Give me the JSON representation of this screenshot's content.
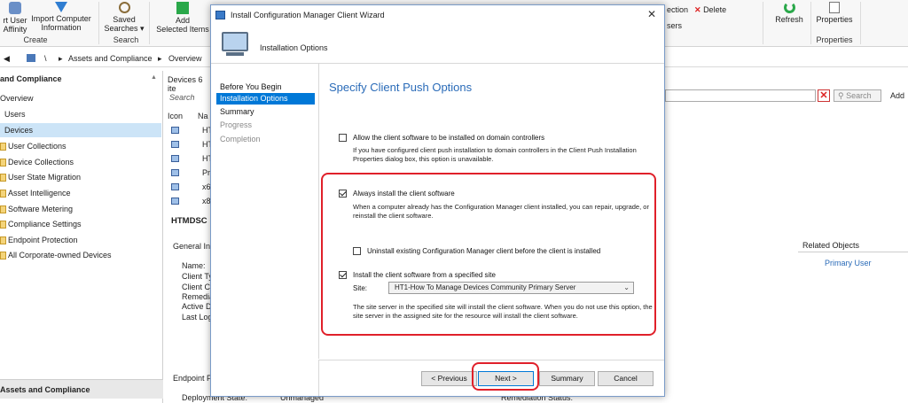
{
  "ribbon": {
    "user_affinity": [
      "rt User",
      "Affinity"
    ],
    "import_computer": [
      "Import Computer",
      "Information"
    ],
    "saved_searches": [
      "Saved",
      "Searches ▾"
    ],
    "add_selected": [
      "Add",
      "Selected Items"
    ],
    "collection_frag": "ection",
    "delete": "Delete",
    "users_frag": "sers",
    "refresh": "Refresh",
    "properties": "Properties",
    "group_create": "Create",
    "group_search": "Search",
    "group_properties": "Properties"
  },
  "address": {
    "root": "\\",
    "crumb1": "Assets and Compliance",
    "crumb2": "Overview",
    "sep": "▸"
  },
  "nav": {
    "header": "and Compliance",
    "items": [
      "Overview",
      "Users",
      "Devices",
      "User Collections",
      "Device Collections",
      "User State Migration",
      "Asset Intelligence",
      "Software Metering",
      "Compliance Settings",
      "Endpoint Protection",
      "All Corporate-owned Devices"
    ],
    "footer": "Assets and Compliance"
  },
  "devices": {
    "header": "Devices 6 ite",
    "search_placeholder": "Search",
    "col_icon": "Icon",
    "col_name": "Na",
    "rows": [
      "HT",
      "HT",
      "HT",
      "Pr",
      "x6",
      "x8"
    ]
  },
  "detail": {
    "name": "HTMDSC",
    "general": "General In",
    "fields": [
      "Name:",
      "Client Ty",
      "Client Ch",
      "Remedia",
      "Active D",
      "Last Log"
    ],
    "endpoint": "Endpoint P",
    "deployment_state_label": "Deployment State:",
    "deployment_state_value": "Unmanaged",
    "remediation_status": "Remediation Status:",
    "related_objects": "Related Objects",
    "primary_user": "Primary User"
  },
  "right_toolbar": {
    "search_button": "Search",
    "add": "Add"
  },
  "dialog": {
    "title": "Install Configuration Manager Client Wizard",
    "header": "Installation Options",
    "steps": [
      {
        "label": "Before You Begin",
        "state": "done"
      },
      {
        "label": "Installation Options",
        "state": "active"
      },
      {
        "label": "Summary",
        "state": "done"
      },
      {
        "label": "Progress",
        "state": "dim"
      },
      {
        "label": "Completion",
        "state": "dim"
      }
    ],
    "page_title": "Specify Client Push Options",
    "opt_domain_controllers": {
      "label": "Allow the client software to be installed on domain controllers",
      "checked": false,
      "note": "If you have configured client push installation to domain controllers in the Client Push Installation Properties dialog box, this option is unavailable."
    },
    "opt_always_install": {
      "label": "Always install the client software",
      "checked": true,
      "note": "When a computer already has the Configuration Manager client installed, you can repair, upgrade, or reinstall the client software."
    },
    "opt_uninstall": {
      "label": "Uninstall existing Configuration Manager client before the client is installed",
      "checked": false
    },
    "opt_specified_site": {
      "label": "Install the client software from a specified site",
      "checked": true
    },
    "site_label": "Site:",
    "site_value": "HT1-How To Manage Devices Community Primary Server",
    "site_note": "The site server in the specified site will install the client software.  When you do not use this option, the site server in the assigned site for the resource will install the client software.",
    "buttons": {
      "previous": "< Previous",
      "next": "Next >",
      "summary": "Summary",
      "cancel": "Cancel"
    }
  },
  "colors": {
    "accent": "#0078d7",
    "highlight": "#e0202a",
    "title_blue": "#2a6bb8"
  }
}
